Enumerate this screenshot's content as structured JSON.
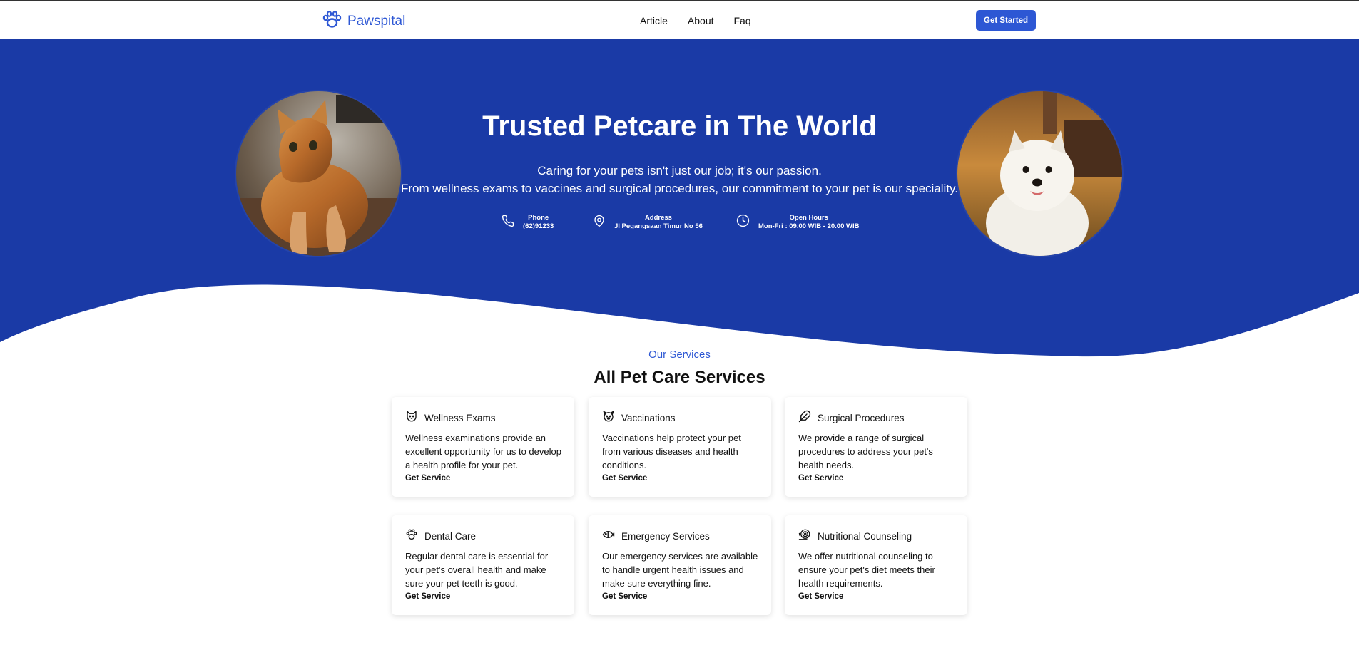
{
  "header": {
    "logo_text": "Pawspital",
    "nav": [
      "Article",
      "About",
      "Faq"
    ],
    "cta_label": "Get Started"
  },
  "hero": {
    "title": "Trusted Petcare in The World",
    "subtitle_line1": "Caring for your pets isn't just our job; it's our passion.",
    "subtitle_line2": "From wellness exams to vaccines and surgical procedures, our commitment to your pet is our speciality.",
    "info": [
      {
        "label": "Phone",
        "value": "(62)91233",
        "icon": "phone-icon"
      },
      {
        "label": "Address",
        "value": "Jl Pegangsaan Timur No 56",
        "icon": "map-pin-icon"
      },
      {
        "label": "Open Hours",
        "value": "Mon-Fri : 09.00 WIB - 20.00 WIB",
        "icon": "clock-icon"
      }
    ],
    "images": [
      "cat-photo",
      "westie-dog-photo"
    ]
  },
  "services": {
    "eyebrow": "Our Services",
    "title": "All Pet Care Services",
    "link_label": "Get Service",
    "items": [
      {
        "title": "Wellness Exams",
        "desc": "Wellness examinations provide an excellent opportunity for us to develop a health profile for your pet.",
        "icon": "cat-face-icon"
      },
      {
        "title": "Vaccinations",
        "desc": "Vaccinations help protect your pet from various diseases and health conditions.",
        "icon": "dog-face-icon"
      },
      {
        "title": "Surgical Procedures",
        "desc": "We provide a range of surgical procedures to address your pet's health needs.",
        "icon": "feather-icon"
      },
      {
        "title": "Dental Care",
        "desc": "Regular dental care is essential for your pet's overall health and make sure your pet teeth is good.",
        "icon": "paw-icon"
      },
      {
        "title": "Emergency Services",
        "desc": "Our emergency services are available to handle urgent health issues and make sure everything fine.",
        "icon": "fish-icon"
      },
      {
        "title": "Nutritional Counseling",
        "desc": "We offer nutritional counseling to ensure your pet's diet meets their health requirements.",
        "icon": "snail-icon"
      }
    ]
  },
  "colors": {
    "brand": "#2d57d4",
    "hero_bg": "#1a3aa6"
  }
}
